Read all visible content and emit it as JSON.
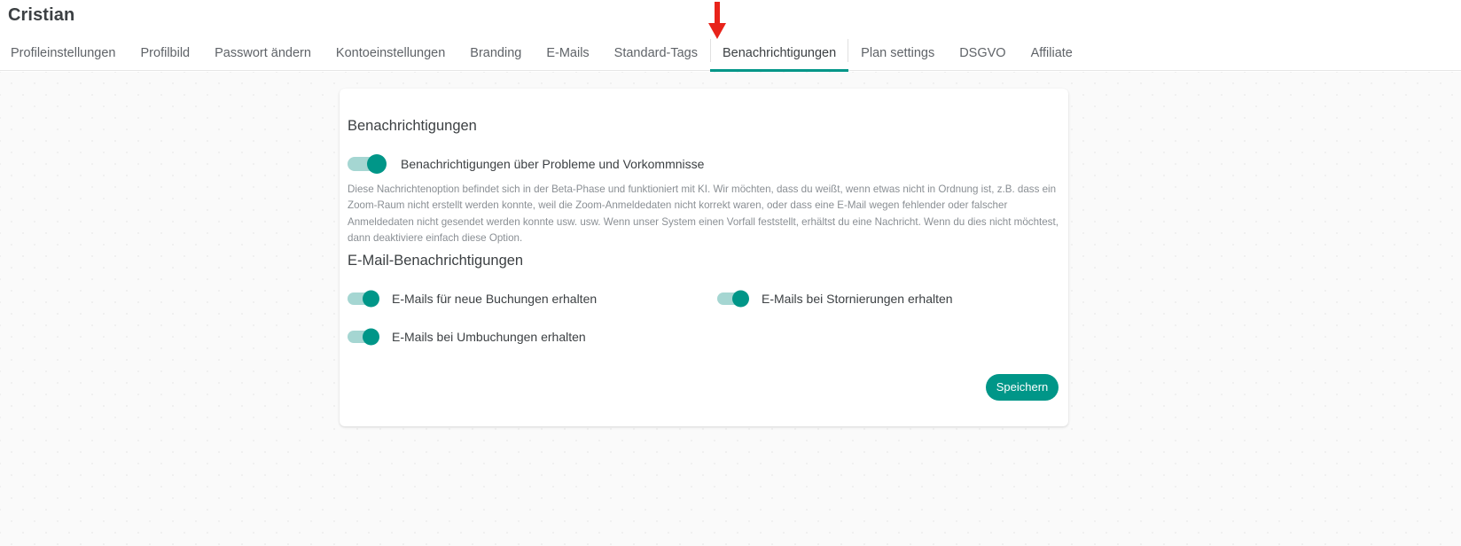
{
  "header": {
    "title": "Cristian",
    "tabs": [
      {
        "label": "Profileinstellungen",
        "active": false
      },
      {
        "label": "Profilbild",
        "active": false
      },
      {
        "label": "Passwort ändern",
        "active": false
      },
      {
        "label": "Kontoeinstellungen",
        "active": false
      },
      {
        "label": "Branding",
        "active": false
      },
      {
        "label": "E-Mails",
        "active": false
      },
      {
        "label": "Standard-Tags",
        "active": false
      },
      {
        "label": "Benachrichtigungen",
        "active": true
      },
      {
        "label": "Plan settings",
        "active": false
      },
      {
        "label": "DSGVO",
        "active": false
      },
      {
        "label": "Affiliate",
        "active": false
      }
    ]
  },
  "annotation": {
    "arrow": "red-down-arrow",
    "color": "#e8231a"
  },
  "card": {
    "notifications_section": {
      "title": "Benachrichtigungen",
      "toggle_label": "Benachrichtigungen über Probleme und Vorkommnisse",
      "toggle_state": "on",
      "description": "Diese Nachrichtenoption befindet sich in der Beta-Phase und funktioniert mit KI. Wir möchten, dass du weißt, wenn etwas nicht in Ordnung ist, z.B. dass ein Zoom-Raum nicht erstellt werden konnte, weil die Zoom-Anmeldedaten nicht korrekt waren, oder dass eine E-Mail wegen fehlender oder falscher Anmeldedaten nicht gesendet werden konnte usw. usw. Wenn unser System einen Vorfall feststellt, erhältst du eine Nachricht. Wenn du dies nicht möchtest, dann deaktiviere einfach diese Option."
    },
    "email_section": {
      "title": "E-Mail-Benachrichtigungen",
      "toggles": [
        {
          "label": "E-Mails für neue Buchungen erhalten",
          "state": "on"
        },
        {
          "label": "E-Mails bei Stornierungen erhalten",
          "state": "on"
        },
        {
          "label": "E-Mails bei Umbuchungen erhalten",
          "state": "on"
        }
      ]
    },
    "save_label": "Speichern"
  },
  "colors": {
    "accent": "#009688",
    "track": "#a5d6d2",
    "annotation": "#e8231a",
    "text": "#3c4043",
    "muted": "#8a8f94"
  }
}
